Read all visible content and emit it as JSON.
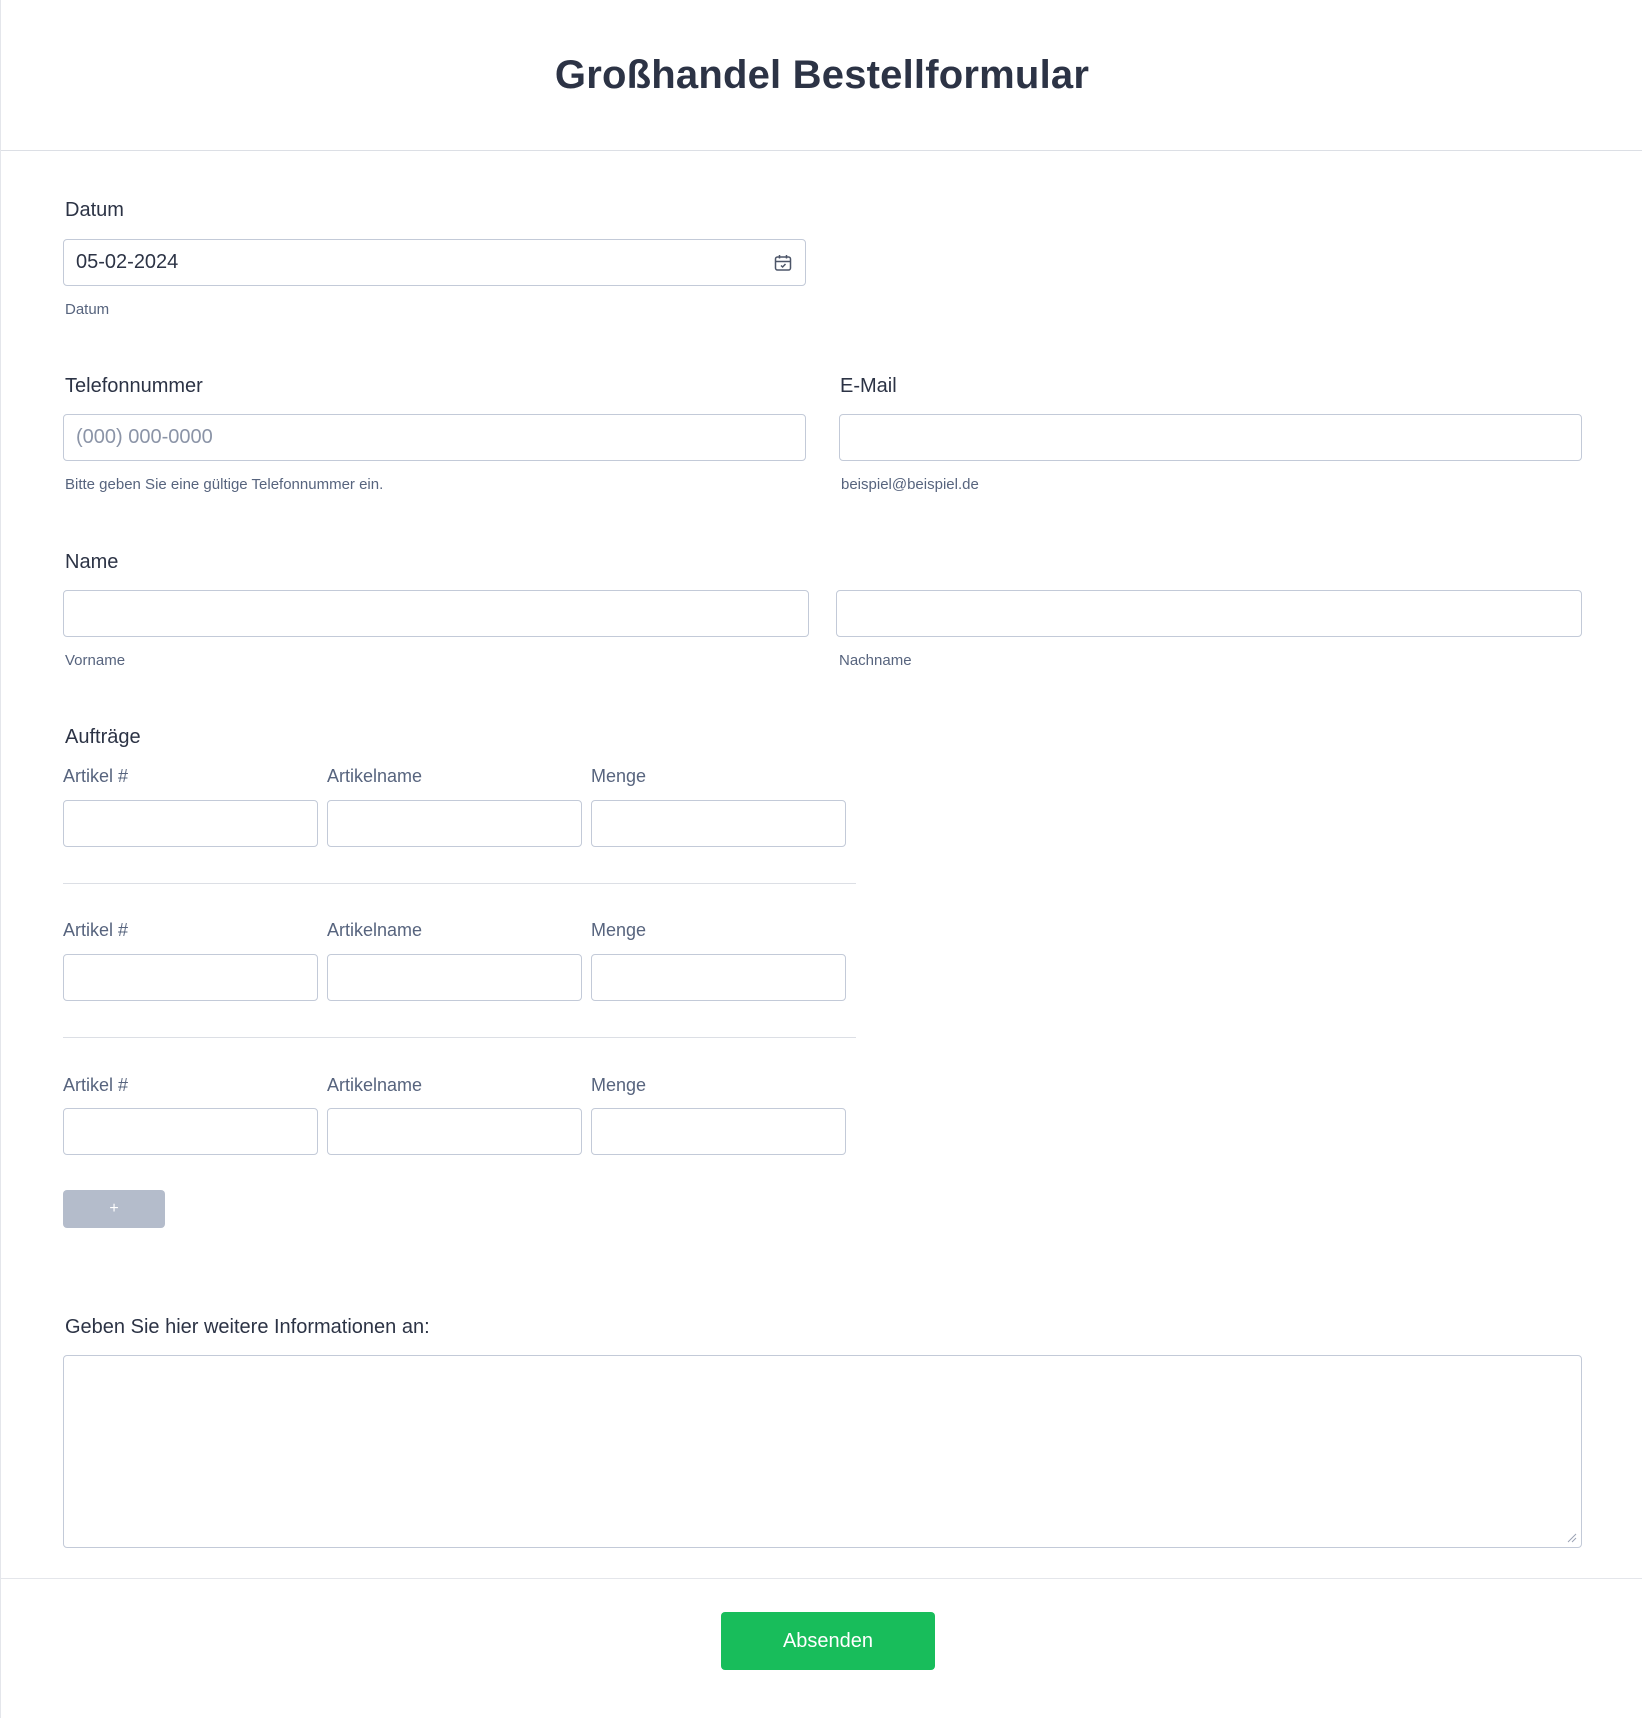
{
  "form": {
    "title": "Großhandel Bestellformular"
  },
  "date": {
    "label": "Datum",
    "value": "05-02-2024",
    "sublabel": "Datum"
  },
  "phone": {
    "label": "Telefonnummer",
    "placeholder": "(000) 000-0000",
    "sublabel": "Bitte geben Sie eine gültige Telefonnummer ein."
  },
  "email": {
    "label": "E-Mail",
    "value": "",
    "sublabel": "beispiel@beispiel.de"
  },
  "name": {
    "label": "Name",
    "first_sublabel": "Vorname",
    "last_sublabel": "Nachname"
  },
  "orders": {
    "label": "Aufträge",
    "rows": [
      {
        "col1": "Artikel #",
        "col2": "Artikelname",
        "col3": "Menge"
      },
      {
        "col1": "Artikel #",
        "col2": "Artikelname",
        "col3": "Menge"
      },
      {
        "col1": "Artikel #",
        "col2": "Artikelname",
        "col3": "Menge"
      }
    ],
    "add_label": "+"
  },
  "additional": {
    "label": "Geben Sie hier weitere Informationen an:"
  },
  "submit": {
    "label": "Absenden"
  },
  "colors": {
    "submit": "#18bd5b",
    "add_button": "#b4bccb",
    "text": "#2c3345"
  }
}
